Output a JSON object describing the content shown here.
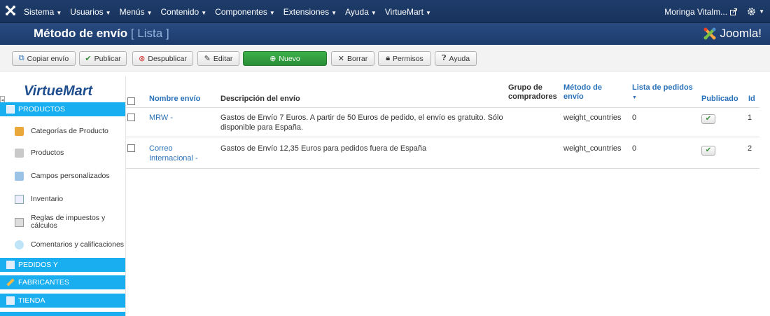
{
  "topbar": {
    "menu": [
      {
        "label": "Sistema"
      },
      {
        "label": "Usuarios"
      },
      {
        "label": "Menús"
      },
      {
        "label": "Contenido"
      },
      {
        "label": "Componentes"
      },
      {
        "label": "Extensiones"
      },
      {
        "label": "Ayuda"
      },
      {
        "label": "VirtueMart"
      }
    ],
    "user": "Moringa Vitalm..."
  },
  "titlebar": {
    "title": "Método de envío",
    "subtitle": "[ Lista ]",
    "brand": "Joomla!"
  },
  "toolbar": {
    "copy": "Copiar envío",
    "publish": "Publicar",
    "unpublish": "Despublicar",
    "edit": "Editar",
    "new": "Nuevo",
    "delete": "Borrar",
    "permissions": "Permisos",
    "help": "Ayuda"
  },
  "sidebar": {
    "logo": "VirtueMart",
    "sections": {
      "productos": "PRODUCTOS",
      "pedidos": "PEDIDOS Y",
      "fabricantes": "FABRICANTES",
      "tienda": "TIENDA"
    },
    "items": [
      {
        "label": "Categorías de Producto"
      },
      {
        "label": "Productos"
      },
      {
        "label": "Campos personalizados"
      },
      {
        "label": "Inventario"
      },
      {
        "label": "Reglas de impuestos y cálculos"
      },
      {
        "label": "Comentarios y calificaciones"
      }
    ]
  },
  "table": {
    "headers": {
      "name": "Nombre envío",
      "description": "Descripción del envío",
      "group": "Grupo de compradores",
      "method": "Método de envío",
      "order_list": "Lista de pedidos",
      "published": "Publicado",
      "id": "Id"
    },
    "rows": [
      {
        "name": "MRW -",
        "description": "Gastos de Envío 7 Euros. A partir de 50 Euros de pedido, el envío es gratuito. Sólo disponible para España.",
        "group": "",
        "method": "weight_countries",
        "order_list": "0",
        "published": true,
        "id": "1"
      },
      {
        "name": "Correo Internacional -",
        "description": "Gastos de Envío 12,35 Euros para pedidos fuera de España",
        "group": "",
        "method": "weight_countries",
        "order_list": "0",
        "published": true,
        "id": "2"
      }
    ]
  }
}
